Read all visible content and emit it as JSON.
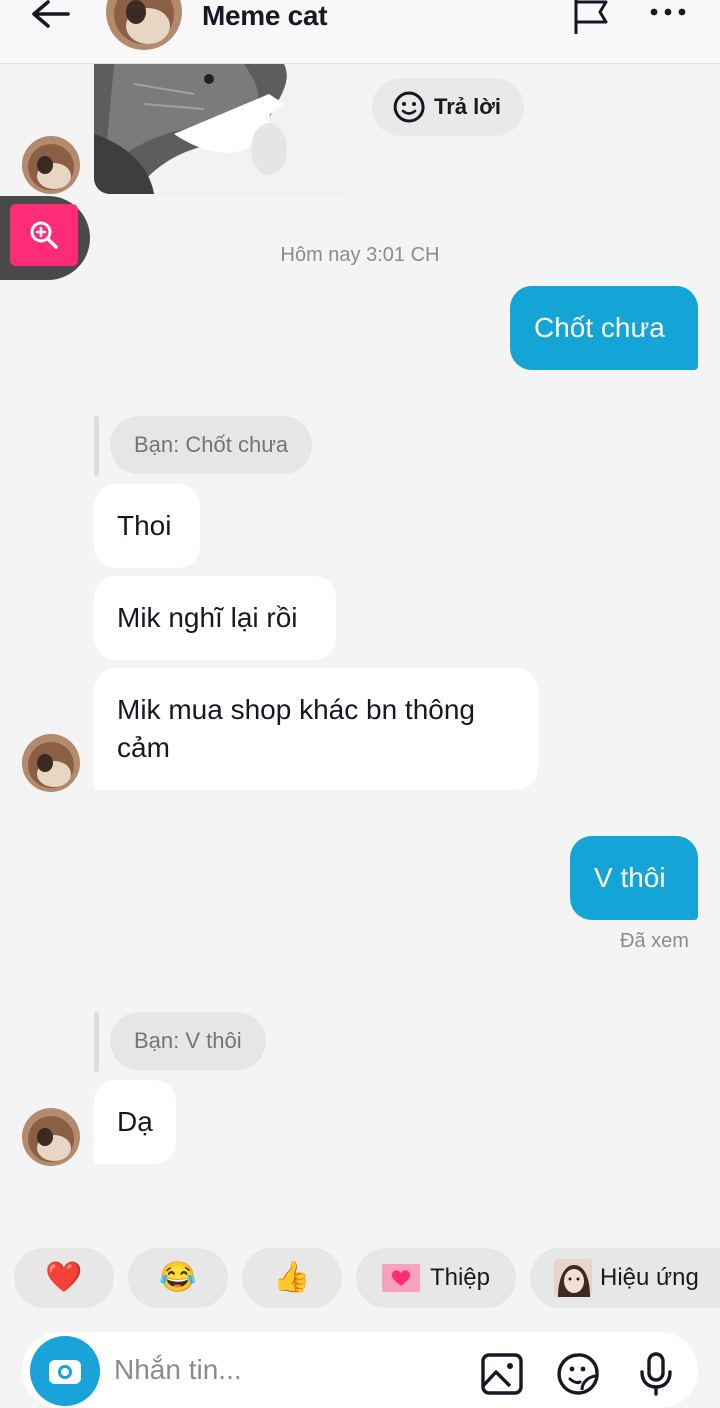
{
  "header": {
    "title": "Meme cat"
  },
  "messages": {
    "reply_label": "Trả lời",
    "timestamp": "Hôm nay 3:01 CH",
    "out_1": "Chốt chưa",
    "quote_1": "Bạn: Chốt chưa",
    "in_1": "Thoi",
    "in_2": "Mik nghĩ lại rồi",
    "in_3_line1": "Mik mua shop khác bn thông",
    "in_3_line2": "cảm",
    "out_2": "V thôi",
    "seen": "Đã xem",
    "quote_2": "Bạn: V thôi",
    "in_4": "Dạ"
  },
  "quick_reactions": [
    {
      "icon": "heart-icon",
      "emoji": "❤️"
    },
    {
      "icon": "laughing-icon",
      "emoji": "😂"
    },
    {
      "icon": "thumbs-up-icon",
      "emoji": "👍"
    },
    {
      "icon": "card-icon",
      "label": "Thiệp"
    },
    {
      "icon": "effect-icon",
      "label": "Hiệu ứng"
    }
  ],
  "composer": {
    "placeholder": "Nhắn tin..."
  },
  "colors": {
    "outgoing_bubble": "#15a4d6",
    "zoom_button": "#fe2c78",
    "background": "#f4f4f4"
  }
}
